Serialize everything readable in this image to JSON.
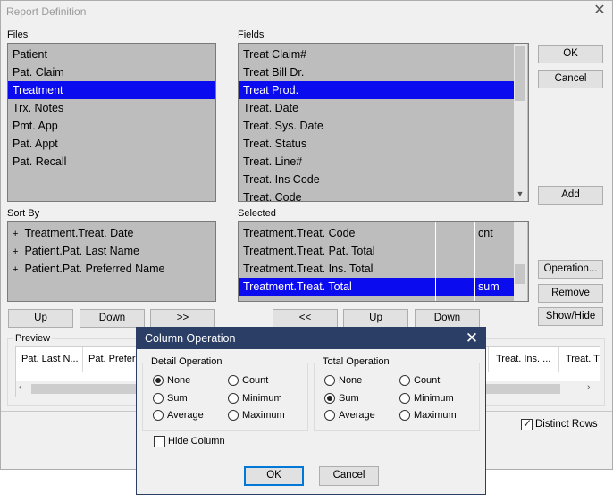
{
  "window": {
    "title": "Report Definition",
    "close_glyph": "✕"
  },
  "files": {
    "label": "Files",
    "items": [
      "Patient",
      "Pat. Claim",
      "Treatment",
      "Trx. Notes",
      "Pmt. App",
      "Pat. Appt",
      "Pat. Recall"
    ],
    "selected_index": 2
  },
  "fields": {
    "label": "Fields",
    "items": [
      "Treat Claim#",
      "Treat Bill Dr.",
      "Treat Prod.",
      "Treat. Date",
      "Treat. Sys. Date",
      "Treat. Status",
      "Treat. Line#",
      "Treat. Ins Code",
      "Treat. Code"
    ],
    "selected_index": 2
  },
  "sort_by": {
    "label": "Sort By",
    "items": [
      "Treatment.Treat. Date",
      "Patient.Pat. Last Name",
      "Patient.Pat. Preferred Name"
    ],
    "prefix": "+"
  },
  "selected": {
    "label": "Selected",
    "rows": [
      {
        "name": "Treatment.Treat. Code",
        "op": "cnt"
      },
      {
        "name": "Treatment.Treat. Pat. Total",
        "op": ""
      },
      {
        "name": "Treatment.Treat. Ins. Total",
        "op": ""
      },
      {
        "name": "Treatment.Treat. Total",
        "op": "sum"
      }
    ],
    "selected_index": 3
  },
  "buttons": {
    "ok": "OK",
    "cancel": "Cancel",
    "add": "Add",
    "operation": "Operation...",
    "remove": "Remove",
    "show_hide": "Show/Hide",
    "sort_up": "Up",
    "sort_down": "Down",
    "move_right": ">>",
    "move_left": "<<",
    "sel_up": "Up",
    "sel_down": "Down"
  },
  "preview": {
    "label": "Preview",
    "columns_left": [
      "Pat. Last N...",
      "Pat. Preferr"
    ],
    "columns_right": [
      "Treat. Ins. ...",
      "Treat. T"
    ]
  },
  "distinct_rows": {
    "label": "Distinct Rows",
    "checked": true
  },
  "dialog": {
    "title": "Column Operation",
    "close_glyph": "✕",
    "detail": {
      "legend": "Detail Operation",
      "options": [
        "None",
        "Count",
        "Sum",
        "Minimum",
        "Average",
        "Maximum"
      ],
      "selected": "None"
    },
    "total": {
      "legend": "Total Operation",
      "options": [
        "None",
        "Count",
        "Sum",
        "Minimum",
        "Average",
        "Maximum"
      ],
      "selected": "Sum"
    },
    "hide_column": {
      "label": "Hide Column",
      "checked": false
    },
    "ok": "OK",
    "cancel": "Cancel"
  }
}
